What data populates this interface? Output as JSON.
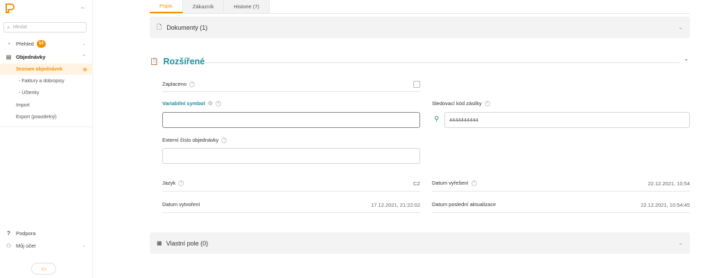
{
  "sidebar": {
    "search_placeholder": "Hledat",
    "items": {
      "prehled": {
        "label": "Přehled",
        "badge": "14"
      },
      "objednavky": {
        "label": "Objednávky"
      },
      "seznam": {
        "label": "Seznam objednávek"
      },
      "faktury": {
        "label": "- Faktury a dobropisy"
      },
      "uctenky": {
        "label": "- Účtenky"
      },
      "import": {
        "label": "Import"
      },
      "export": {
        "label": "Export (pravidelný)"
      },
      "podpora": {
        "label": "Podpora"
      },
      "ucet": {
        "label": "Můj účet"
      }
    }
  },
  "tabs": [
    "Popis",
    "Zákazník",
    "Historie (7)"
  ],
  "panels": {
    "dokumenty": "Dokumenty (1)",
    "vlastni": "Vlastní pole (0)"
  },
  "section": {
    "title": "Rozšířené",
    "zaplaceno_label": "Zaplaceno",
    "vs_label": "Variabilní symbol",
    "vs_value": "",
    "tracking_label": "Sledovací kód zásilky",
    "tracking_value": "4444444444",
    "ext_label": "Externí číslo objednávky",
    "ext_value": "",
    "jazyk_label": "Jazyk",
    "jazyk_value": "CZ",
    "datum_vyreseni_label": "Datum vyřešení",
    "datum_vyreseni_value": "22.12.2021, 10:54",
    "datum_vytvoreni_label": "Datum vytvoření",
    "datum_vytvoreni_value": "17.12.2021, 21:22:02",
    "datum_aktualizace_label": "Datum poslední aktualizace",
    "datum_aktualizace_value": "22.12.2021, 10:54:45"
  },
  "colors": {
    "accent": "#f39200",
    "teal": "#1a8f99"
  },
  "icons": [
    "logo-icon",
    "collapse-arrow-icon",
    "search-icon",
    "dashboard-icon",
    "orders-icon",
    "add-circle-icon",
    "help-icon",
    "user-icon",
    "document-icon",
    "clipboard-icon",
    "grid-icon",
    "location-pin-icon",
    "gear-icon",
    "chevron-down-icon",
    "chevron-up-icon"
  ]
}
